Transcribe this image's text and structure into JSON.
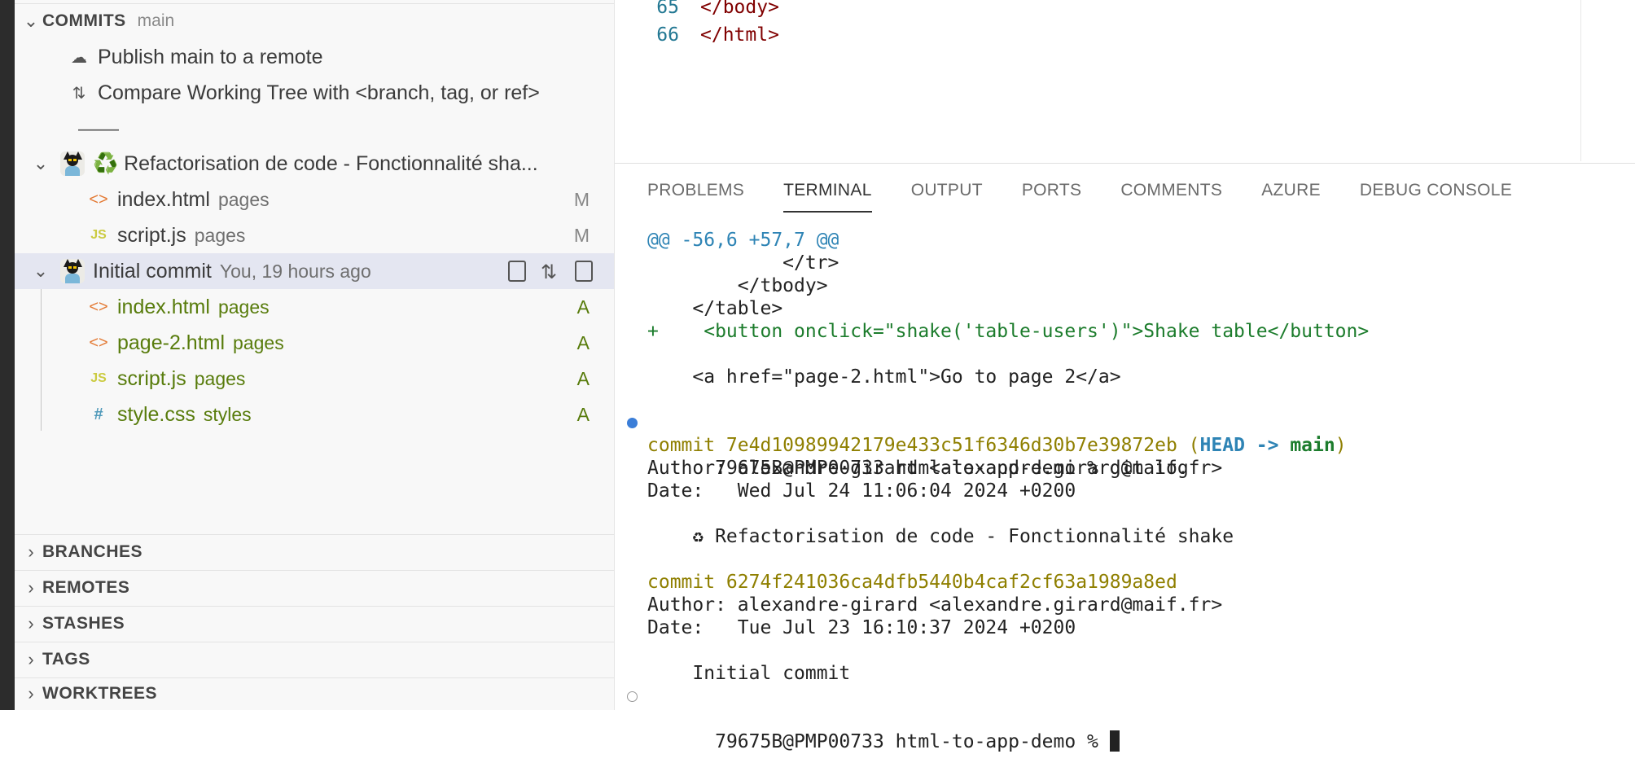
{
  "sidebar": {
    "commits_section": {
      "title": "COMMITS",
      "branch": "main"
    },
    "actions": {
      "publish": "Publish main to a remote",
      "compare": "Compare Working Tree with <branch, tag, or ref>",
      "separator": "——"
    },
    "commits": [
      {
        "message": "♻️ Refactorisation de code - Fonctionnalité sha...",
        "meta": "",
        "files": [
          {
            "name": "index.html",
            "folder": "pages",
            "status": "M",
            "icon": "html-icon"
          },
          {
            "name": "script.js",
            "folder": "pages",
            "status": "M",
            "icon": "js-icon"
          }
        ]
      },
      {
        "message": "Initial commit",
        "meta": "You, 19 hours ago",
        "files": [
          {
            "name": "index.html",
            "folder": "pages",
            "status": "A",
            "icon": "html-icon"
          },
          {
            "name": "page-2.html",
            "folder": "pages",
            "status": "A",
            "icon": "html-icon"
          },
          {
            "name": "script.js",
            "folder": "pages",
            "status": "A",
            "icon": "js-icon"
          },
          {
            "name": "style.css",
            "folder": "styles",
            "status": "A",
            "icon": "css-icon"
          }
        ]
      }
    ],
    "sections": [
      "BRANCHES",
      "REMOTES",
      "STASHES",
      "TAGS",
      "WORKTREES"
    ]
  },
  "editor": {
    "lines": [
      {
        "num": "65",
        "code": "</body>"
      },
      {
        "num": "66",
        "code": "</html>"
      }
    ]
  },
  "panel": {
    "tabs": [
      "PROBLEMS",
      "TERMINAL",
      "OUTPUT",
      "PORTS",
      "COMMENTS",
      "AZURE",
      "DEBUG CONSOLE"
    ],
    "active_tab": "TERMINAL",
    "terminal": {
      "hunk": "@@ -56,6 +57,7 @@",
      "ctx1": "            </tr>",
      "ctx2": "        </tbody>",
      "ctx3": "    </table>",
      "added": "+    <button onclick=\"shake('table-users')\">Shake table</button>",
      "ctx4": "    <a href=\"page-2.html\">Go to page 2</a>",
      "prompt1": "79675B@PMP00733 html-to-app-demo % git log",
      "commit1_hash": "commit 7e4d10989942179e433c51f6346d30b7e39872eb",
      "commit1_paren_open": " (",
      "commit1_head": "HEAD -> ",
      "commit1_main": "main",
      "commit1_paren_close": ")",
      "commit1_author": "Author: alexandre-girard <alexandre.girard@maif.fr>",
      "commit1_date": "Date:   Wed Jul 24 11:06:04 2024 +0200",
      "commit1_msg": "    ♻ Refactorisation de code - Fonctionnalité shake",
      "commit2_hash": "commit 6274f241036ca4dfb5440b4caf2cf63a1989a8ed",
      "commit2_author": "Author: alexandre-girard <alexandre.girard@maif.fr>",
      "commit2_date": "Date:   Tue Jul 23 16:10:37 2024 +0200",
      "commit2_msg": "    Initial commit",
      "prompt2": "79675B@PMP00733 html-to-app-demo % "
    }
  },
  "colors": {
    "added_status": "#587c0c",
    "selection": "#e4e6f1",
    "terminal_hash": "#8f7f00",
    "terminal_hunk": "#2e84b5"
  }
}
